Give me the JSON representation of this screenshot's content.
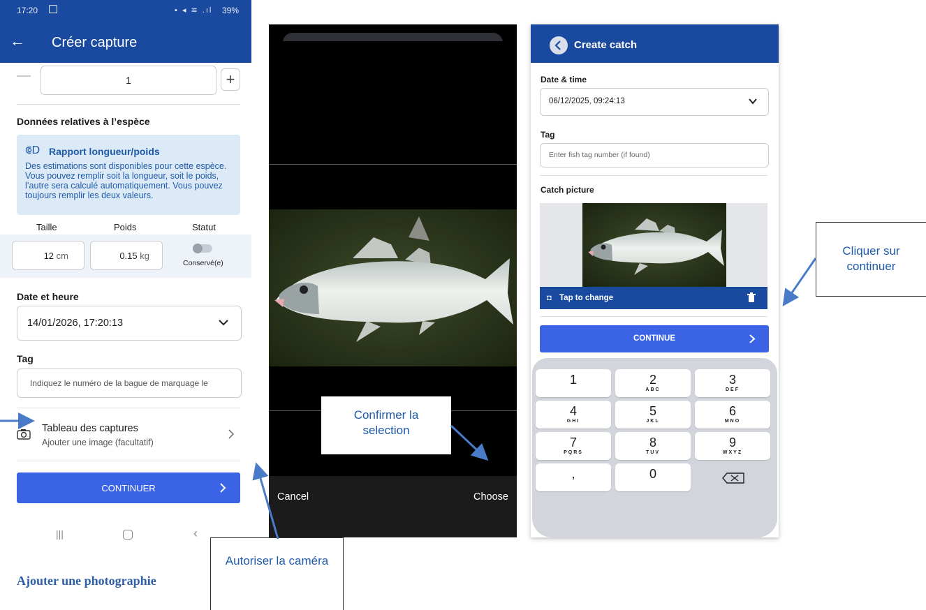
{
  "screen1": {
    "status_time": "17:20",
    "status_right": "39%",
    "title": "Créer capture",
    "quantity_value": "1",
    "species_heading": "Données relatives à l’espèce",
    "info_title": "Rapport longueur/poids",
    "info_text": "Des estimations sont disponibles pour cette espèce. Vous pouvez remplir soit la longueur, soit le poids, l’autre sera calculé automatiquement. Vous pouvez toujours remplir les deux valeurs.",
    "col_size": "Taille",
    "col_weight": "Poids",
    "col_status": "Statut",
    "size_value": "12",
    "size_unit": "cm",
    "weight_value": "0.15",
    "weight_unit": "kg",
    "status_label": "Conservé(e)",
    "date_label": "Date et heure",
    "date_value": "14/01/2026, 17:20:13",
    "tag_label": "Tag",
    "tag_placeholder": "Indiquez le numéro de la bague de marquage le",
    "picture_title": "Tableau des captures",
    "picture_sub": "Ajouter une image (facultatif)",
    "continue": "CONTINUER"
  },
  "screen2": {
    "cancel": "Cancel",
    "choose": "Choose"
  },
  "screen3": {
    "title": "Create catch",
    "date_label": "Date & time",
    "date_value": "06/12/2025, 09:24:13",
    "tag_label": "Tag",
    "tag_placeholder": "Enter fish tag number (if found)",
    "picture_label": "Catch picture",
    "tap_change": "Tap to change",
    "continue": "CONTINUE",
    "keys": [
      {
        "n": "1",
        "l": ""
      },
      {
        "n": "2",
        "l": "ABC"
      },
      {
        "n": "3",
        "l": "DEF"
      },
      {
        "n": "4",
        "l": "GHI"
      },
      {
        "n": "5",
        "l": "JKL"
      },
      {
        "n": "6",
        "l": "MNO"
      },
      {
        "n": "7",
        "l": "PQRS"
      },
      {
        "n": "8",
        "l": "TUV"
      },
      {
        "n": "9",
        "l": "WXYZ"
      },
      {
        "n": ",",
        "l": ""
      },
      {
        "n": "0",
        "l": ""
      }
    ]
  },
  "annotations": {
    "caption": "Ajouter une photographie",
    "callout_camera": "Autoriser la caméra",
    "callout_confirm": "Confirmer la selection",
    "callout_continue": "Cliquer sur continuer"
  },
  "colors": {
    "app_blue": "#1a4aa0",
    "button_blue": "#3a63e6",
    "info_bg": "#dceaf8",
    "callout_text": "#1f5aa8"
  }
}
